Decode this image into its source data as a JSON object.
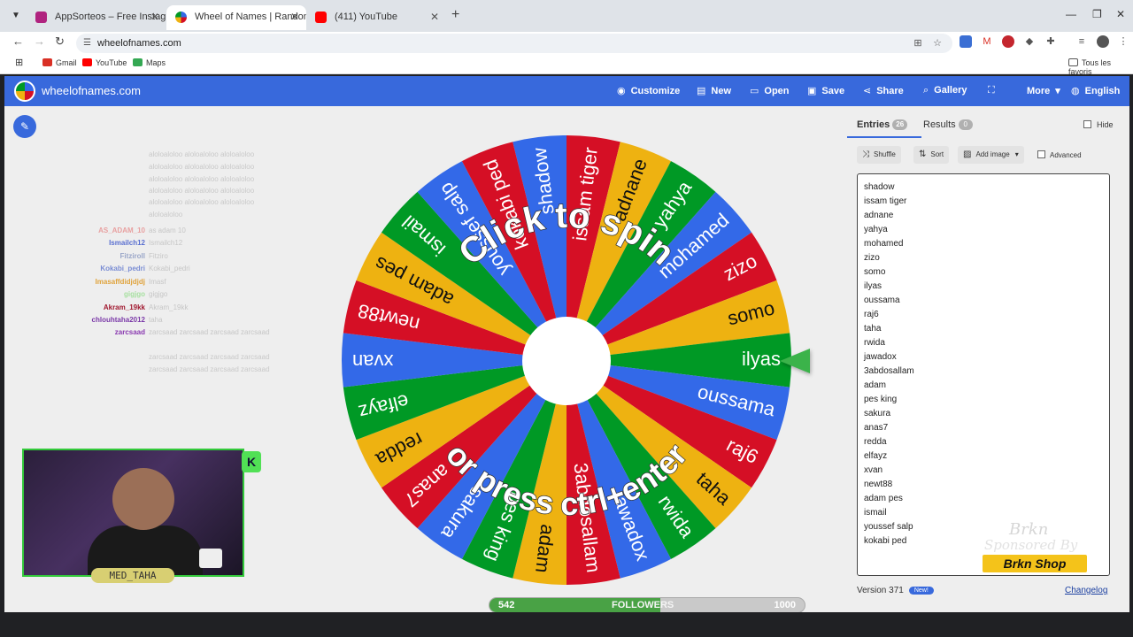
{
  "browser": {
    "tabs": [
      {
        "title": "AppSorteos – Free Instagram C",
        "color": "#b0237f"
      },
      {
        "title": "Wheel of Names | Random nam",
        "color": "#3869dc"
      },
      {
        "title": "(411) YouTube",
        "color": "#ff0000"
      }
    ],
    "url": "wheelofnames.com",
    "bookmarks": [
      {
        "label": "Gmail",
        "color": "#d93025"
      },
      {
        "label": "YouTube",
        "color": "#ff0000"
      },
      {
        "label": "Maps",
        "color": "#34a853"
      }
    ],
    "all_bookmarks": "Tous les favoris"
  },
  "app": {
    "brand": "wheelofnames.com",
    "menu": [
      {
        "label": "Customize",
        "icon": "palette-icon"
      },
      {
        "label": "New",
        "icon": "file-icon"
      },
      {
        "label": "Open",
        "icon": "folder-icon"
      },
      {
        "label": "Save",
        "icon": "save-icon"
      },
      {
        "label": "Share",
        "icon": "share-icon"
      },
      {
        "label": "Gallery",
        "icon": "search-icon"
      },
      {
        "label": "",
        "icon": "fullscreen-icon"
      },
      {
        "label": "More",
        "icon": "chevron-down-icon"
      },
      {
        "label": "English",
        "icon": "globe-icon"
      }
    ]
  },
  "chat": {
    "faint_lines": [
      "aloloaloloo aloloaloloo aloloaloloo",
      "aloloaloloo aloloaloloo aloloaloloo",
      "aloloaloloo aloloaloloo aloloaloloo",
      "aloloaloloo aloloaloloo aloloaloloo",
      "aloloaloloo aloloaloloo aloloaloloo",
      "aloloaloloo"
    ],
    "messages": [
      {
        "user": "AS_ADAM_10",
        "msg": "as adam 10",
        "color": "#e8a0a0"
      },
      {
        "user": "Ismailch12",
        "msg": "Ismailch12",
        "color": "#5a6fd0"
      },
      {
        "user": "Fitziroll",
        "msg": "Fitziro",
        "color": "#9aa6c8"
      },
      {
        "user": "Kokabi_pedri",
        "msg": "Kokabi_pedri",
        "color": "#7a8dd4"
      },
      {
        "user": "Imasaffdidjdjdj",
        "msg": "Imasf",
        "color": "#e0a33c"
      },
      {
        "user": "gigjgo",
        "msg": "gigjgo",
        "color": "#a7e0a0"
      },
      {
        "user": "Akram_19kk",
        "msg": "Akram_19kk",
        "color": "#a0172e"
      },
      {
        "user": "chlouhtaha2012",
        "msg": "taha",
        "color": "#7b3aa8"
      },
      {
        "user": "zarcsaad",
        "msg": "zarcsaad zarcsaad zarcsaad zarcsaad",
        "color": "#8a3ab0"
      }
    ],
    "extra_faint": [
      "zarcsaad zarcsaad zarcsaad zarcsaad",
      "zarcsaad zarcsaad zarcsaad zarcsaad"
    ]
  },
  "webcam": {
    "name": "MED_TAHA",
    "badge": "K"
  },
  "wheel": {
    "prompt_top": "Click to spin",
    "prompt_bottom": "or press ctrl+enter",
    "colors": [
      "#3369e8",
      "#d50f25",
      "#eeb211",
      "#009925"
    ],
    "pointer_color": "#3bb34a"
  },
  "followers": {
    "current": "542",
    "label": "FOLLOWERS",
    "goal": "1000",
    "progress": 0.542
  },
  "panel": {
    "tab_entries": "Entries",
    "entries_count": "26",
    "tab_results": "Results",
    "results_count": "0",
    "hide_label": "Hide",
    "shuffle_label": "Shuffle",
    "sort_label": "Sort",
    "add_image_label": "Add image",
    "advanced_label": "Advanced",
    "entries": [
      "shadow",
      "issam tiger",
      "adnane",
      "yahya",
      "mohamed",
      "zizo",
      "somo",
      "ilyas",
      "oussama",
      "raj6",
      "taha",
      "rwida",
      "jawadox",
      "3abdosallam",
      "adam",
      "pes king",
      "sakura",
      "anas7",
      "redda",
      "elfayz",
      "xvan",
      "newt88",
      "adam pes",
      "ismail",
      "youssef salp",
      "kokabi ped"
    ],
    "version": "Version 371",
    "new_badge": "New!",
    "changelog": "Changelog"
  },
  "sponsor": {
    "line1": "Brkn",
    "line2": "Sponsored By",
    "line3": "Brkn Shop"
  }
}
